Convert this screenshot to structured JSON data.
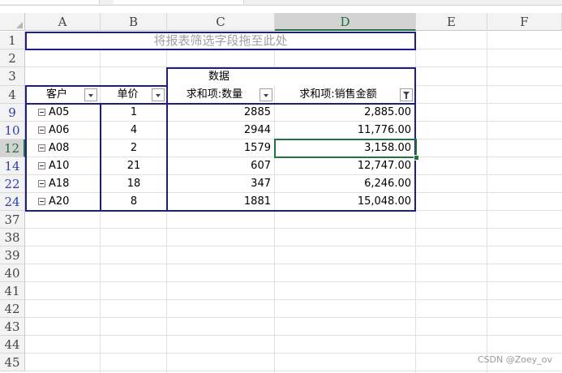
{
  "columns": [
    "A",
    "B",
    "C",
    "D",
    "E",
    "F"
  ],
  "rows": [
    "1",
    "2",
    "3",
    "4",
    "9",
    "10",
    "12",
    "14",
    "22",
    "24",
    "37",
    "38",
    "39",
    "40",
    "41",
    "42",
    "43",
    "44",
    "45"
  ],
  "filter_drop_hint": "将报表筛选字段拖至此处",
  "pivot": {
    "data_label": "数据",
    "headers": {
      "customer": "客户",
      "price": "单价",
      "sum_qty": "求和项:数量",
      "sum_sales": "求和项:销售金额"
    },
    "records": [
      {
        "customer": "A05",
        "price": "1",
        "qty": "2885",
        "sales": "2,885.00"
      },
      {
        "customer": "A06",
        "price": "4",
        "qty": "2944",
        "sales": "11,776.00"
      },
      {
        "customer": "A08",
        "price": "2",
        "qty": "1579",
        "sales": "3,158.00"
      },
      {
        "customer": "A10",
        "price": "21",
        "qty": "607",
        "sales": "12,747.00"
      },
      {
        "customer": "A18",
        "price": "18",
        "qty": "347",
        "sales": "6,246.00"
      },
      {
        "customer": "A20",
        "price": "8",
        "qty": "1881",
        "sales": "15,048.00"
      }
    ]
  },
  "watermark": "CSDN @Zoey_ov",
  "selected_cell": "D12",
  "colors": {
    "accent": "#217346",
    "pivot_border": "#1c1c8c",
    "filtered_row_number": "#2f3ea8"
  }
}
